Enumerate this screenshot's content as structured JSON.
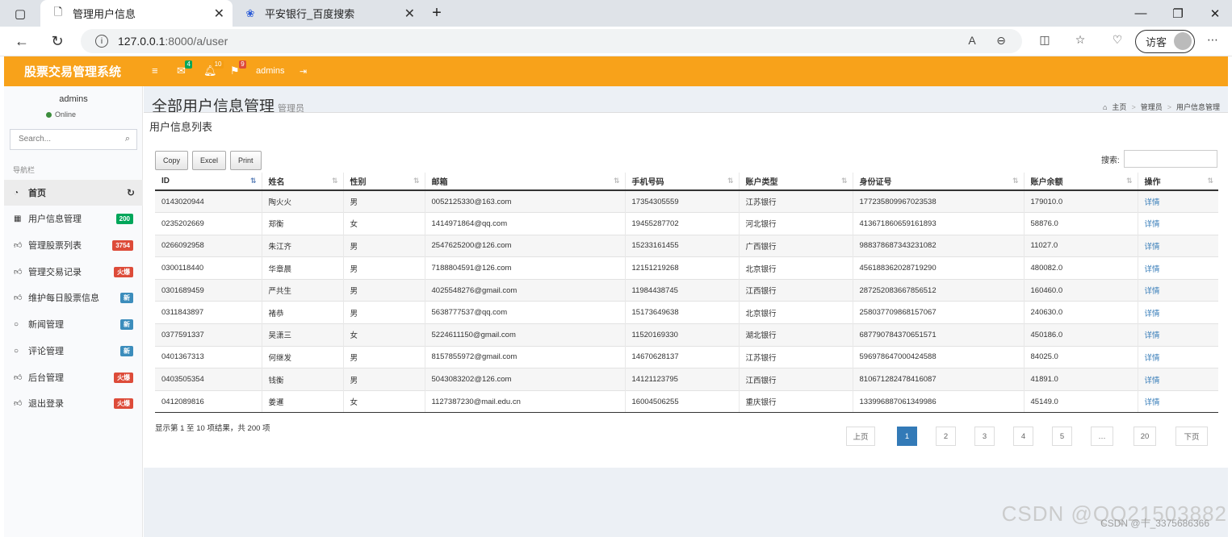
{
  "browser": {
    "tabs": [
      {
        "title": "管理用户信息",
        "icon": "page-icon",
        "active": true
      },
      {
        "title": "平安银行_百度搜索",
        "icon": "baidu-paw-icon",
        "active": false
      }
    ],
    "new_tab_symbol": "+",
    "url_host": "127.0.0.1",
    "url_path": ":8000/a/user",
    "guest_label": "访客"
  },
  "header": {
    "brand": "股票交易管理系统",
    "mail_count": "4",
    "bell_count": "10",
    "flag_count": "9",
    "username": "admins",
    "colors": {
      "bar": "#f8a21a"
    }
  },
  "sidebar": {
    "username": "admins",
    "status": "Online",
    "search_placeholder": "Search...",
    "nav_header": "导航栏",
    "items": [
      {
        "label": "首页",
        "icon": "dashboard-icon",
        "badge": "",
        "active": true
      },
      {
        "label": "用户信息管理",
        "icon": "grid-icon",
        "badge": "200",
        "badge_color": "#00a65a"
      },
      {
        "label": "管理股票列表",
        "icon": "thumbs-up-icon",
        "badge": "3754",
        "badge_color": "#dd4b39"
      },
      {
        "label": "管理交易记录",
        "icon": "thumbs-up-icon",
        "badge": "火爆",
        "badge_color": "#dd4b39"
      },
      {
        "label": "维护每日股票信息",
        "icon": "thumbs-up-icon",
        "badge": "新",
        "badge_color": "#3c8dbc"
      },
      {
        "label": "新闻管理",
        "icon": "comment-icon",
        "badge": "新",
        "badge_color": "#3c8dbc"
      },
      {
        "label": "评论管理",
        "icon": "comment-icon",
        "badge": "新",
        "badge_color": "#3c8dbc"
      },
      {
        "label": "后台管理",
        "icon": "thumbs-up-icon",
        "badge": "火爆",
        "badge_color": "#dd4b39"
      },
      {
        "label": "退出登录",
        "icon": "thumbs-up-icon",
        "badge": "火爆",
        "badge_color": "#dd4b39"
      }
    ]
  },
  "page": {
    "title": "全部用户信息管理",
    "subtitle": "管理员",
    "breadcrumb": [
      "主页",
      "管理员",
      "用户信息管理"
    ],
    "box_title": "用户信息列表",
    "buttons": [
      "Copy",
      "Excel",
      "Print"
    ],
    "search_label": "搜索:"
  },
  "table": {
    "columns": [
      "ID",
      "姓名",
      "性别",
      "邮箱",
      "手机号码",
      "账户类型",
      "身份证号",
      "账户余额",
      "操作"
    ],
    "rows": [
      [
        "0143020944",
        "陶火火",
        "男",
        "0052125330@163.com",
        "17354305559",
        "江苏银行",
        "177235809967023538",
        "179010.0",
        "详情"
      ],
      [
        "0235202669",
        "郑衡",
        "女",
        "1414971864@qq.com",
        "19455287702",
        "河北银行",
        "413671860659161893",
        "58876.0",
        "详情"
      ],
      [
        "0266092958",
        "朱江齐",
        "男",
        "2547625200@126.com",
        "15233161455",
        "广西银行",
        "988378687343231082",
        "11027.0",
        "详情"
      ],
      [
        "0300118440",
        "华章晨",
        "男",
        "7188804591@126.com",
        "12151219268",
        "北京银行",
        "456188362028719290",
        "480082.0",
        "详情"
      ],
      [
        "0301689459",
        "严共生",
        "男",
        "4025548276@gmail.com",
        "11984438745",
        "江西银行",
        "287252083667856512",
        "160460.0",
        "详情"
      ],
      [
        "0311843897",
        "褚恭",
        "男",
        "5638777537@qq.com",
        "15173649638",
        "北京银行",
        "258037709868157067",
        "240630.0",
        "详情"
      ],
      [
        "0377591337",
        "吴潇三",
        "女",
        "5224611150@gmail.com",
        "11520169330",
        "湖北银行",
        "687790784370651571",
        "450186.0",
        "详情"
      ],
      [
        "0401367313",
        "何继发",
        "男",
        "8157855972@gmail.com",
        "14670628137",
        "江苏银行",
        "596978647000424588",
        "84025.0",
        "详情"
      ],
      [
        "0403505354",
        "钱衡",
        "男",
        "5043083202@126.com",
        "14121123795",
        "江西银行",
        "810671282478416087",
        "41891.0",
        "详情"
      ],
      [
        "0412089816",
        "姜暹",
        "女",
        "1127387230@mail.edu.cn",
        "16004506255",
        "重庆银行",
        "133996887061349986",
        "45149.0",
        "详情"
      ]
    ]
  },
  "footer": {
    "info": "显示第 1 至 10 项结果，共 200 项",
    "pages": [
      "上页",
      "1",
      "2",
      "3",
      "4",
      "5",
      "…",
      "20",
      "下页"
    ],
    "current_page": "1"
  },
  "watermark": {
    "main": "CSDN @QQ21503882",
    "sub": "CSDN @十_3375686366"
  }
}
